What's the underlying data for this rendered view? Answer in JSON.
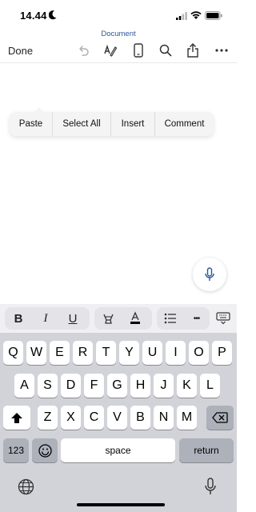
{
  "status_bar": {
    "time": "14.44"
  },
  "document": {
    "title": "Document"
  },
  "toolbar": {
    "done_label": "Done"
  },
  "context_menu": {
    "items": [
      "Paste",
      "Select All",
      "Insert",
      "Comment"
    ]
  },
  "format_bar": {
    "bold": "B",
    "italic": "I",
    "underline": "U",
    "more": "•••"
  },
  "keyboard": {
    "row1": [
      "Q",
      "W",
      "E",
      "R",
      "T",
      "Y",
      "U",
      "I",
      "O",
      "P"
    ],
    "row2": [
      "A",
      "S",
      "D",
      "F",
      "G",
      "H",
      "J",
      "K",
      "L"
    ],
    "row3": [
      "Z",
      "X",
      "C",
      "V",
      "B",
      "N",
      "M"
    ],
    "numbers_label": "123",
    "space_label": "space",
    "return_label": "return"
  },
  "colors": {
    "accent": "#2b579a",
    "keyboard_bg": "#d1d3d9",
    "dark_key": "#adb1ba"
  }
}
